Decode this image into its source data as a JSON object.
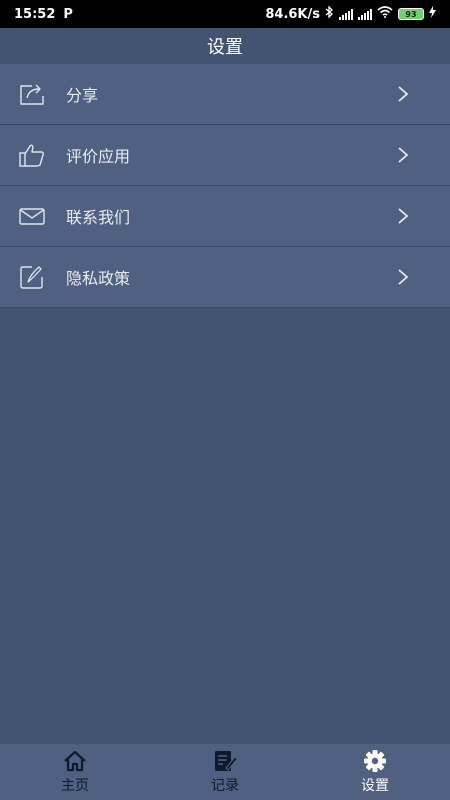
{
  "status_bar": {
    "time": "15:52",
    "net_speed": "84.6K/s",
    "battery": "93"
  },
  "header": {
    "title": "设置"
  },
  "settings": [
    {
      "label": "分享",
      "icon": "share-icon"
    },
    {
      "label": "评价应用",
      "icon": "thumbs-up-icon"
    },
    {
      "label": "联系我们",
      "icon": "mail-icon"
    },
    {
      "label": "隐私政策",
      "icon": "policy-edit-icon"
    }
  ],
  "tabs": [
    {
      "label": "主页",
      "icon": "home-icon",
      "active": false
    },
    {
      "label": "记录",
      "icon": "record-icon",
      "active": false
    },
    {
      "label": "设置",
      "icon": "gear-icon",
      "active": true
    }
  ],
  "colors": {
    "background": "#435473",
    "row": "#4f6080",
    "tab_inactive": "#0f1a2c",
    "tab_active": "#ffffff"
  }
}
